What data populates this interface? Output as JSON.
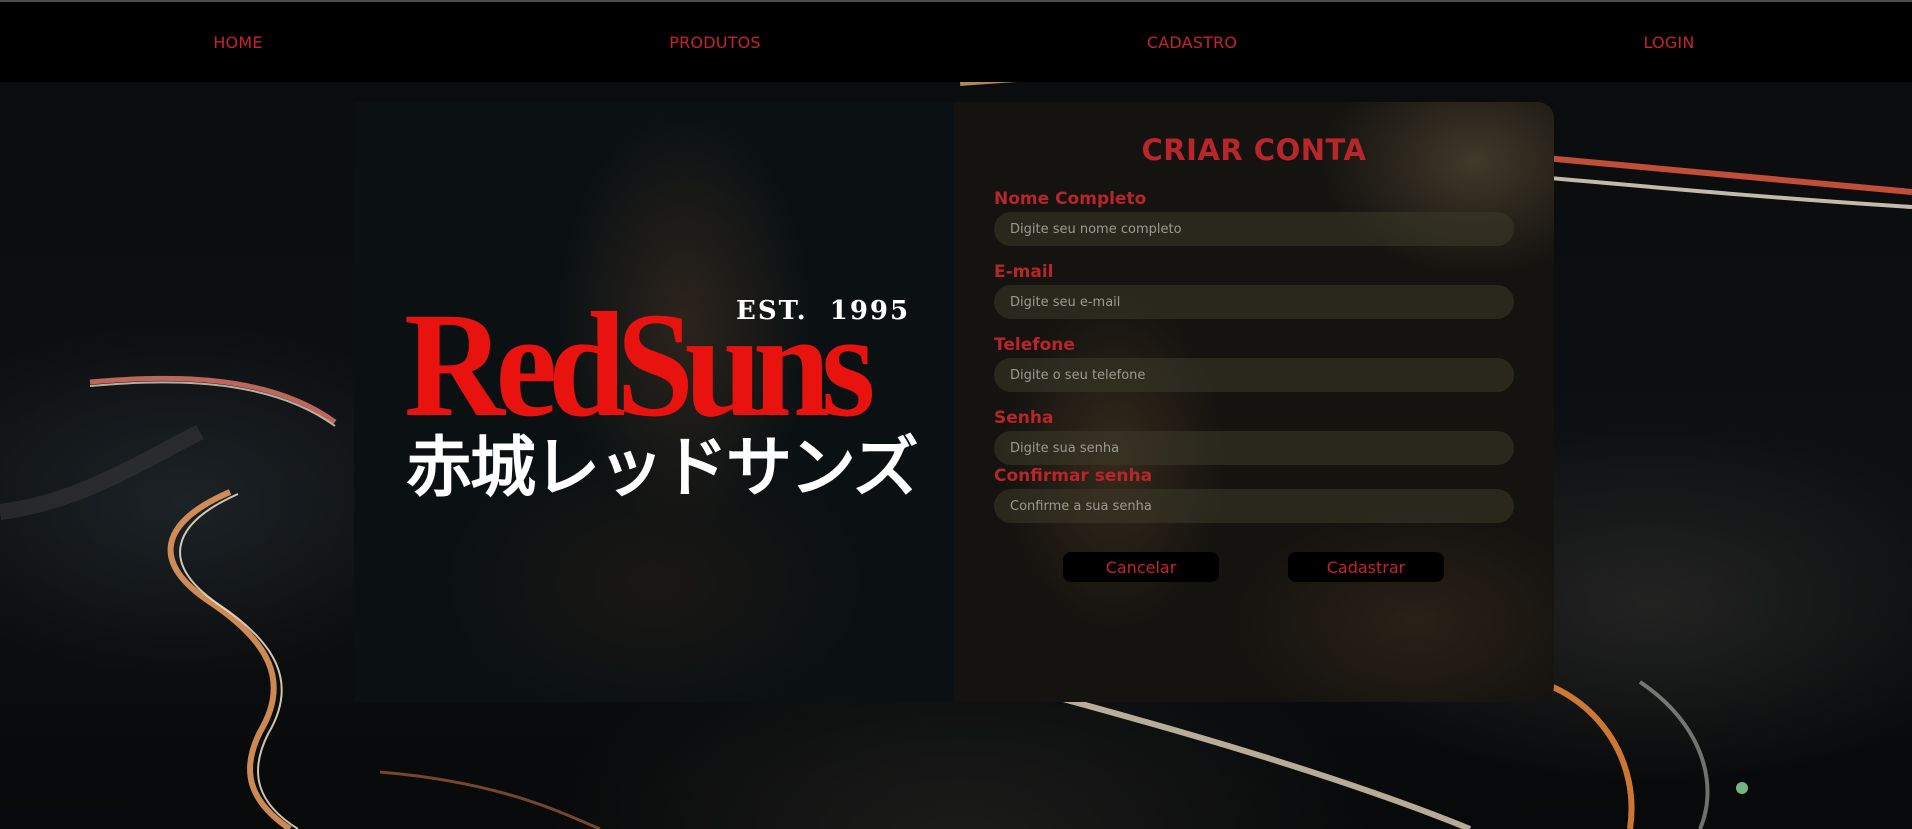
{
  "nav": {
    "items": [
      {
        "label": "HOME"
      },
      {
        "label": "PRODUTOS"
      },
      {
        "label": "CADASTRO"
      },
      {
        "label": "LOGIN"
      }
    ]
  },
  "logo": {
    "brand": "RedSuns",
    "established": "EST.  1995",
    "japanese": "赤城レッドサンズ"
  },
  "form": {
    "title": "CRIAR CONTA",
    "fields": [
      {
        "label": "Nome Completo",
        "placeholder": "Digite seu nome completo",
        "value": ""
      },
      {
        "label": "E-mail",
        "placeholder": "Digite seu e-mail",
        "value": ""
      },
      {
        "label": "Telefone",
        "placeholder": "Digite o seu telefone",
        "value": ""
      },
      {
        "label": "Senha",
        "placeholder": "Digite sua senha",
        "value": ""
      },
      {
        "label": "Confirmar senha",
        "placeholder": "Confirme a sua senha",
        "value": ""
      }
    ],
    "cancel_label": "Cancelar",
    "submit_label": "Cadastrar"
  },
  "colors": {
    "accent": "#c8232c",
    "brand_red": "#e8120f",
    "nav_background": "#000000"
  }
}
